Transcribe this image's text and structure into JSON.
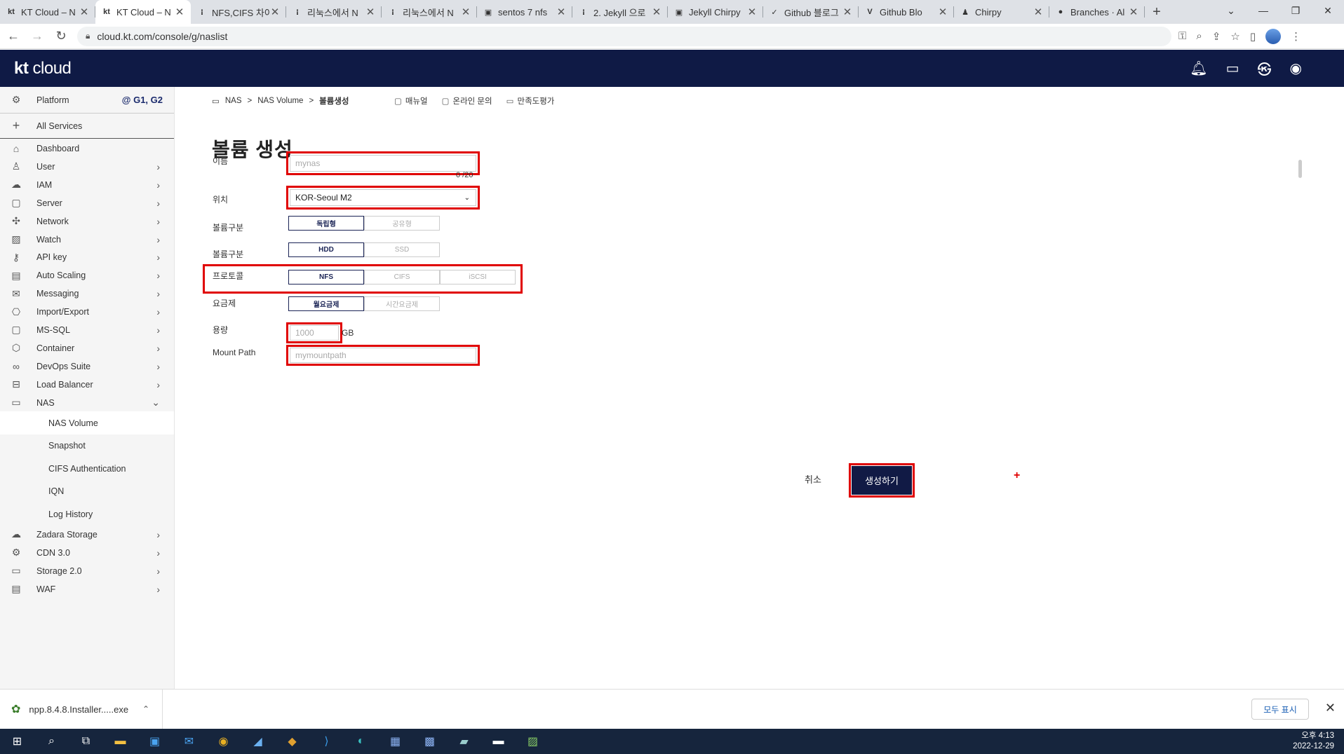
{
  "browser": {
    "tabs": [
      {
        "title": "KT Cloud – N",
        "fav": "kt",
        "active": false
      },
      {
        "title": "KT Cloud – N",
        "fav": "kt",
        "active": true
      },
      {
        "title": "NFS,CIFS 차이",
        "fav": "⁝",
        "active": false
      },
      {
        "title": "리눅스에서 N",
        "fav": "⁝",
        "active": false
      },
      {
        "title": "리눅스에서 N",
        "fav": "⁝",
        "active": false
      },
      {
        "title": "sentos 7 nfs",
        "fav": "▣",
        "active": false
      },
      {
        "title": "2. Jekyll 으로",
        "fav": "⁝",
        "active": false
      },
      {
        "title": "Jekyll Chirpy",
        "fav": "▣",
        "active": false
      },
      {
        "title": "Github 블로그",
        "fav": "✓",
        "active": false
      },
      {
        "title": "Github Blo",
        "fav": "V",
        "active": false
      },
      {
        "title": "Chirpy",
        "fav": "♟",
        "active": false
      },
      {
        "title": "Branches · Al",
        "fav": "●",
        "active": false
      }
    ],
    "new_tab": "+",
    "url": "cloud.kt.com/console/g/naslist"
  },
  "header": {
    "logo_bold": "kt",
    "logo_light": " cloud"
  },
  "sidebar": {
    "platform_label": "Platform",
    "platform_tag": "@ G1, G2",
    "all_services": "All Services",
    "items": [
      {
        "label": "Dashboard",
        "icon": "⌂",
        "chevron": false
      },
      {
        "label": "User",
        "icon": "♙",
        "chevron": true
      },
      {
        "label": "IAM",
        "icon": "☁",
        "chevron": true
      },
      {
        "label": "Server",
        "icon": "▢",
        "chevron": true
      },
      {
        "label": "Network",
        "icon": "✣",
        "chevron": true
      },
      {
        "label": "Watch",
        "icon": "▨",
        "chevron": true
      },
      {
        "label": "API key",
        "icon": "⚷",
        "chevron": true
      },
      {
        "label": "Auto Scaling",
        "icon": "▤",
        "chevron": true
      },
      {
        "label": "Messaging",
        "icon": "✉",
        "chevron": true
      },
      {
        "label": "Import/Export",
        "icon": "⎔",
        "chevron": true
      },
      {
        "label": "MS-SQL",
        "icon": "▢",
        "chevron": true
      },
      {
        "label": "Container",
        "icon": "⬡",
        "chevron": true
      },
      {
        "label": "DevOps Suite",
        "icon": "∞",
        "chevron": true
      },
      {
        "label": "Load Balancer",
        "icon": "⊟",
        "chevron": true
      },
      {
        "label": "NAS",
        "icon": "▭",
        "chevron": true
      }
    ],
    "nas_sub": [
      "NAS Volume",
      "Snapshot",
      "CIFS Authentication",
      "IQN",
      "Log History"
    ],
    "items_after": [
      {
        "label": "Zadara Storage",
        "icon": "☁",
        "chevron": true
      },
      {
        "label": "CDN 3.0",
        "icon": "⚙",
        "chevron": true
      },
      {
        "label": "Storage 2.0",
        "icon": "▭",
        "chevron": true
      },
      {
        "label": "WAF",
        "icon": "▤",
        "chevron": true
      }
    ]
  },
  "breadcrumb": [
    "NAS",
    ">",
    "NAS Volume",
    ">",
    "볼륨생성"
  ],
  "top_links": [
    "매뉴얼",
    "온라인 문의",
    "만족도평가"
  ],
  "form": {
    "title": "볼륨 생성",
    "name_label": "이름",
    "name_placeholder": "mynas",
    "name_counter": "0 /20",
    "location_label": "위치",
    "location_value": "KOR-Seoul M2",
    "volume_type_label": "볼륨구분",
    "volume_type_options": [
      "독립형",
      "공유형"
    ],
    "disk_type_label": "볼륨구분",
    "disk_type_options": [
      "HDD",
      "SSD"
    ],
    "protocol_label": "프로토콜",
    "protocol_options": [
      "NFS",
      "CIFS",
      "iSCSI"
    ],
    "plan_label": "요금제",
    "plan_options": [
      "월요금제",
      "시간요금제"
    ],
    "capacity_label": "용량",
    "capacity_placeholder": "1000",
    "capacity_unit": "GB",
    "mount_label": "Mount Path",
    "mount_placeholder": "mymountpath",
    "cancel": "취소",
    "create": "생성하기",
    "plus": "+"
  },
  "download": {
    "file": "npp.8.4.8.Installer.....exe",
    "show_all": "모두 표시"
  },
  "taskbar": {
    "time": "오후 4:13",
    "date": "2022-12-29"
  }
}
